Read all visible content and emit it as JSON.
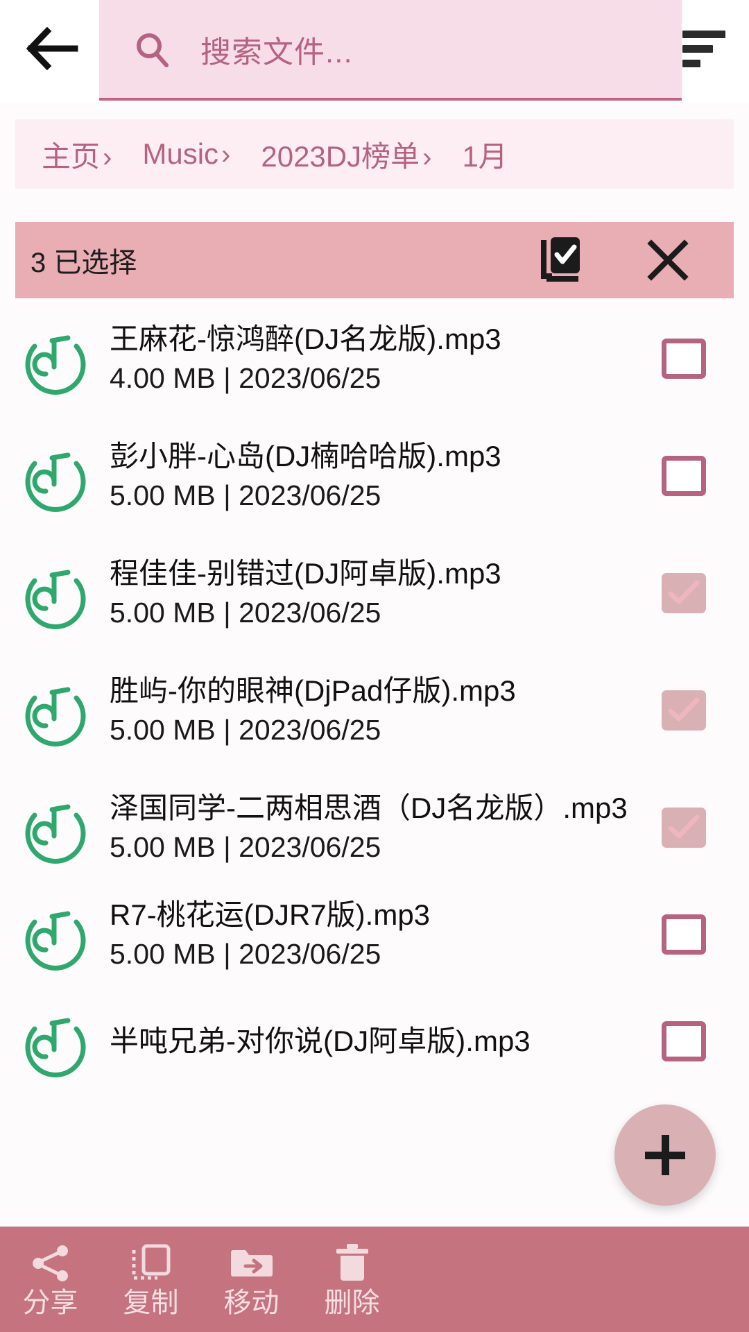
{
  "topbar": {
    "back_icon": "arrow-left-icon",
    "search_icon": "search-icon",
    "search_value": "",
    "search_placeholder": "搜索文件...",
    "sort_icon": "sort-icon"
  },
  "breadcrumb": {
    "separator": "›",
    "items": [
      {
        "label": "主页",
        "has_sep": true
      },
      {
        "label": "Music",
        "has_sep": true
      },
      {
        "label": "2023DJ榜单",
        "has_sep": true
      },
      {
        "label": "1月",
        "has_sep": false
      }
    ]
  },
  "selection_bar": {
    "count_label": "3 已选择",
    "select_all_icon": "library-add-check-icon",
    "close_icon": "close-icon"
  },
  "files": [
    {
      "name": "王麻花-惊鸿醉(DJ名龙版).mp3",
      "meta": "4.00 MB | 2023/06/25",
      "size": "4.00 MB",
      "date": "2023/06/25",
      "checked": false,
      "icon": "music-note-icon"
    },
    {
      "name": "彭小胖-心岛(DJ楠哈哈版).mp3",
      "meta": "5.00 MB | 2023/06/25",
      "size": "5.00 MB",
      "date": "2023/06/25",
      "checked": false,
      "icon": "music-note-icon"
    },
    {
      "name": "程佳佳-别错过(DJ阿卓版).mp3",
      "meta": "5.00 MB | 2023/06/25",
      "size": "5.00 MB",
      "date": "2023/06/25",
      "checked": true,
      "icon": "music-note-icon"
    },
    {
      "name": "胜屿-你的眼神(DjPad仔版).mp3",
      "meta": "5.00 MB | 2023/06/25",
      "size": "5.00 MB",
      "date": "2023/06/25",
      "checked": true,
      "icon": "music-note-icon"
    },
    {
      "name": "泽国同学-二两相思酒（DJ名龙版）.mp3",
      "meta": "5.00 MB | 2023/06/25",
      "size": "5.00 MB",
      "date": "2023/06/25",
      "checked": true,
      "icon": "music-note-icon"
    },
    {
      "name": "R7-桃花运(DJR7版).mp3",
      "meta": "5.00 MB | 2023/06/25",
      "size": "5.00 MB",
      "date": "2023/06/25",
      "checked": false,
      "icon": "music-note-icon"
    },
    {
      "name": "半吨兄弟-对你说(DJ阿卓版).mp3",
      "meta": "",
      "size": "",
      "date": "",
      "checked": false,
      "icon": "music-note-icon"
    }
  ],
  "fab": {
    "icon": "plus-icon",
    "label": "+"
  },
  "bottom_bar": {
    "actions": [
      {
        "label": "分享",
        "icon": "share-icon"
      },
      {
        "label": "复制",
        "icon": "copy-icon"
      },
      {
        "label": "移动",
        "icon": "move-to-folder-icon"
      },
      {
        "label": "删除",
        "icon": "trash-icon"
      }
    ]
  },
  "colors": {
    "search_bg": "#f7dde7",
    "breadcrumb_bg": "#fdeef3",
    "selection_bar_bg": "#e9adb4",
    "bottom_bar_bg": "#c4737f",
    "accent_pink": "#b5637e",
    "music_icon_green": "#2fa86e",
    "checkbox_checked_bg": "#d9b0b4",
    "page_bg": "#fdfbfc"
  }
}
